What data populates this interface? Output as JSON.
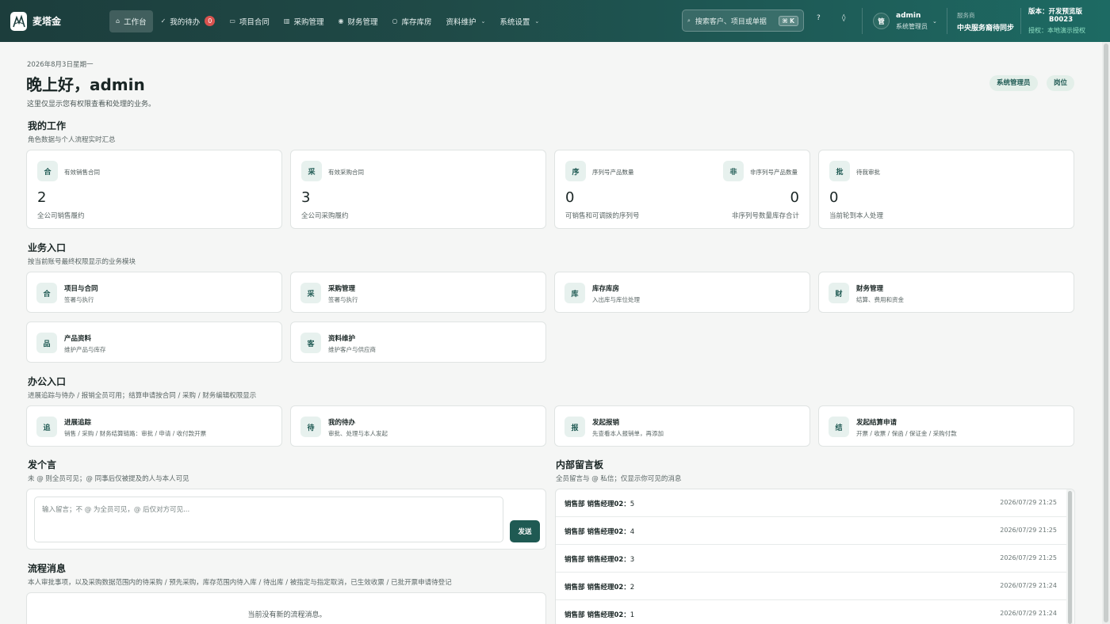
{
  "app": {
    "name": "麦塔金",
    "logo_icon": "mountain-logo-icon"
  },
  "nav": [
    {
      "id": "workbench",
      "icon": "⌂",
      "label": "工作台",
      "active": true
    },
    {
      "id": "todo",
      "icon": "✓",
      "label": "我的待办",
      "badge": "0"
    },
    {
      "id": "projects",
      "icon": "▭",
      "label": "项目合同"
    },
    {
      "id": "purchase",
      "icon": "▥",
      "label": "采购管理"
    },
    {
      "id": "finance",
      "icon": "◉",
      "label": "财务管理"
    },
    {
      "id": "inventory",
      "icon": "○",
      "label": "库存库房"
    },
    {
      "id": "masterdata",
      "icon": "",
      "label": "资料维护",
      "dropdown": true
    },
    {
      "id": "settings",
      "icon": "",
      "label": "系统设置",
      "dropdown": true
    }
  ],
  "search": {
    "placeholder": "搜索客户、项目或单据",
    "shortcut": "⌘ K"
  },
  "header": {
    "help": "?",
    "notify": "◊",
    "user": {
      "avatar": "管",
      "name": "admin",
      "role": "系统管理员"
    },
    "service": {
      "label": "服务商",
      "value": "中央服务裔待同步"
    },
    "version": {
      "line1": "版本：开发预览版",
      "line2": "B0023",
      "line3": "授权：本地演示授权"
    }
  },
  "page": {
    "date": "2026年8月3日星期一",
    "greeting": "晚上好，admin",
    "subtitle": "这里仅显示您有权限查看和处理的业务。",
    "pills": [
      "系统管理员",
      "岗位"
    ]
  },
  "my_work": {
    "title": "我的工作",
    "subtitle": "角色数据与个人流程实时汇总",
    "cards": [
      {
        "icon": "合",
        "label": "有效销售合同",
        "value": "2",
        "desc": "全公司销售履约"
      },
      {
        "icon": "采",
        "label": "有效采购合同",
        "value": "3",
        "desc": "全公司采购履约"
      },
      {
        "icon": "序",
        "label": "序列号产品数量",
        "value": "0",
        "desc": "可销售和可调拨的序列号",
        "right": {
          "icon": "非",
          "label": "非序列号产品数量",
          "value": "0",
          "desc": "非序列号数量库存合计"
        }
      },
      {
        "icon": "批",
        "label": "待我审批",
        "value": "0",
        "desc": "当前轮到本人处理"
      }
    ]
  },
  "business": {
    "title": "业务入口",
    "subtitle": "按当前账号最终权限显示的业务模块",
    "items": [
      {
        "icon": "合",
        "title": "项目与合同",
        "desc": "签署与执行"
      },
      {
        "icon": "采",
        "title": "采购管理",
        "desc": "签署与执行"
      },
      {
        "icon": "库",
        "title": "库存库房",
        "desc": "入出库与库位处理"
      },
      {
        "icon": "财",
        "title": "财务管理",
        "desc": "结算、费用和资金"
      },
      {
        "icon": "品",
        "title": "产品资料",
        "desc": "维护产品与库存"
      },
      {
        "icon": "客",
        "title": "资料维护",
        "desc": "维护客户与供应商"
      }
    ]
  },
  "office": {
    "title": "办公入口",
    "subtitle": "进展追踪与待办 / 报销全员可用；结算申请按合同 / 采购 / 财务编辑权限显示",
    "items": [
      {
        "icon": "追",
        "title": "进展追踪",
        "desc": "销售 / 采购 / 财务结算链路：审批 / 申请 / 收付款开票"
      },
      {
        "icon": "待",
        "title": "我的待办",
        "desc": "审批、处理与本人发起"
      },
      {
        "icon": "报",
        "title": "发起报销",
        "desc": "先查看本人报销单，再添加"
      },
      {
        "icon": "结",
        "title": "发起结算申请",
        "desc": "开票 / 收票 / 保函 / 保证金 / 采购付款"
      }
    ]
  },
  "post": {
    "title": "发个言",
    "subtitle": "未 @ 则全员可见；@ 同事后仅被提及的人与本人可见",
    "placeholder": "输入留言；不 @ 为全员可见，@ 后仅对方可见...",
    "send": "发送"
  },
  "board": {
    "title": "内部留言板",
    "subtitle": "全员留言与 @ 私信；仅显示你可见的消息",
    "rows": [
      {
        "who": "销售部 销售经理02：",
        "text": "5",
        "when": "2026/07/29 21:25"
      },
      {
        "who": "销售部 销售经理02：",
        "text": "4",
        "when": "2026/07/29 21:25"
      },
      {
        "who": "销售部 销售经理02：",
        "text": "3",
        "when": "2026/07/29 21:25"
      },
      {
        "who": "销售部 销售经理02：",
        "text": "2",
        "when": "2026/07/29 21:24"
      },
      {
        "who": "销售部 销售经理02：",
        "text": "1",
        "when": "2026/07/29 21:24"
      }
    ]
  },
  "flow": {
    "title": "流程消息",
    "subtitle": "本人审批事项，以及采购数据范围内的待采购 / 预先采购，库存范围内待入库 / 待出库 / 被指定与指定取消，已生效收票 / 已批开票申请待登记",
    "empty": "当前没有新的流程消息。"
  }
}
